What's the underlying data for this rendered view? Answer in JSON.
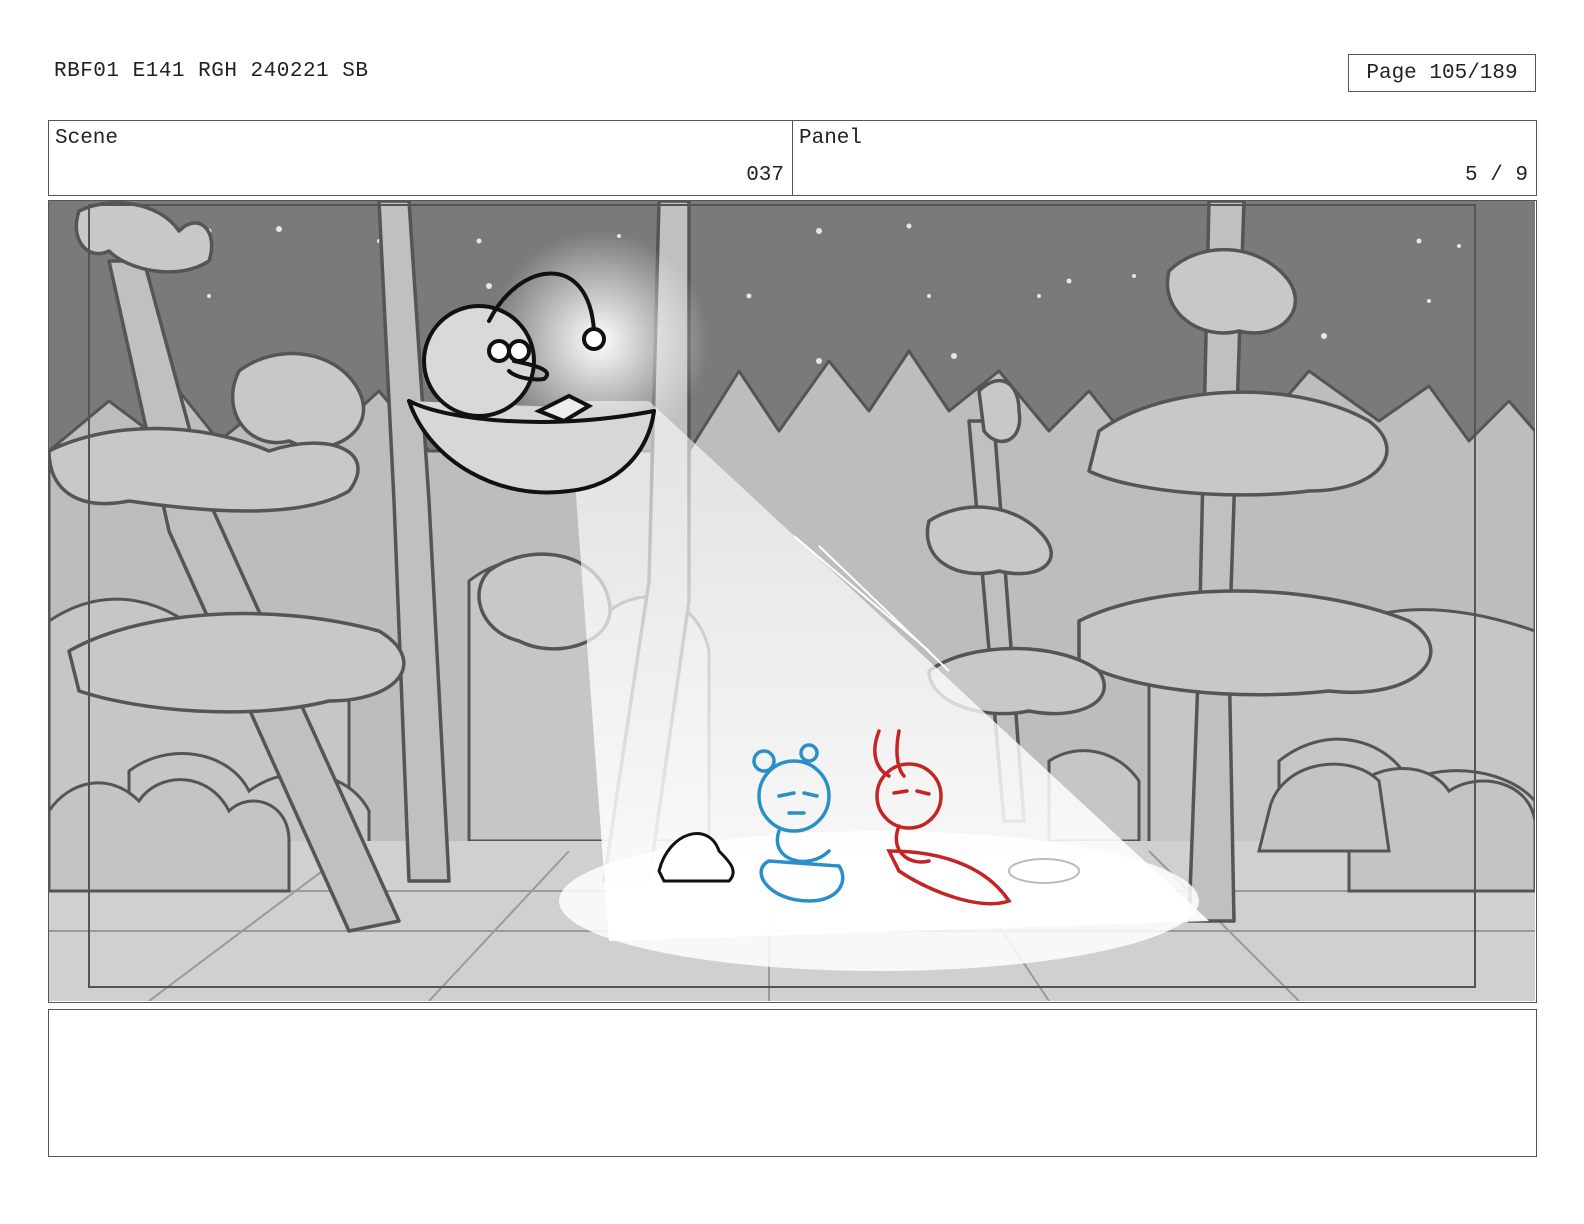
{
  "header": {
    "title": "RBF01 E141 RGH 240221 SB",
    "page": "Page 105/189"
  },
  "scene": {
    "label": "Scene",
    "value": "037"
  },
  "panel": {
    "label": "Panel",
    "value": "5 / 9"
  },
  "artwork": {
    "description_icon": "storyboard-sketch",
    "colors": {
      "sky": "#7a7a7a",
      "foliage": "#c4c4c4",
      "ground": "#cfcfcf",
      "line": "#555555",
      "light": "#ffffff",
      "character_blue": "#2a8fc8",
      "character_red": "#c42424",
      "character_black": "#111111"
    }
  },
  "notes": {
    "text": ""
  }
}
